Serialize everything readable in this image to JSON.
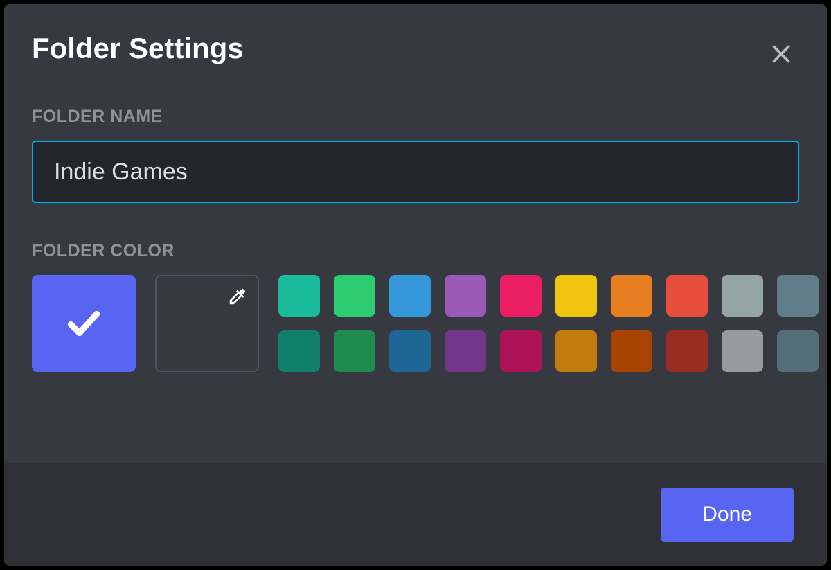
{
  "modal": {
    "title": "Folder Settings",
    "sections": {
      "name": {
        "label": "FOLDER NAME",
        "value": "Indie Games"
      },
      "color": {
        "label": "FOLDER COLOR",
        "selected": "#5865f2",
        "swatches_row1": [
          "#1abc9c",
          "#2ecc71",
          "#3498db",
          "#9b59b6",
          "#e91e63",
          "#f1c40f",
          "#e67e22",
          "#e74c3c",
          "#95a5a6",
          "#607d8b"
        ],
        "swatches_row2": [
          "#11806a",
          "#1f8b4c",
          "#206694",
          "#71368a",
          "#ad1457",
          "#c27c0e",
          "#a84300",
          "#992d22",
          "#979c9f",
          "#546e7a"
        ]
      }
    },
    "footer": {
      "done_label": "Done"
    }
  }
}
